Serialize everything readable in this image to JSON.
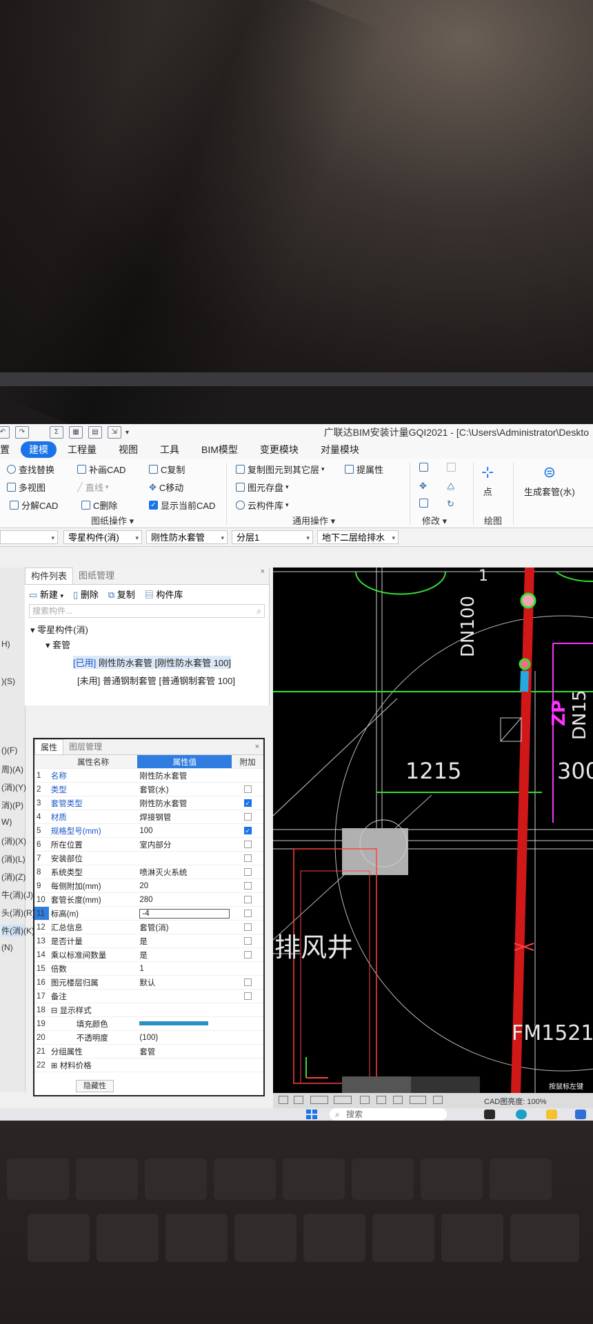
{
  "window": {
    "title": "广联达BIM安装计量GQI2021 - [C:\\Users\\Administrator\\Deskto"
  },
  "menu": [
    "置",
    "建模",
    "工程量",
    "视图",
    "工具",
    "BIM模型",
    "变更模块",
    "对量模块"
  ],
  "ribbon": {
    "find_replace": "查找替换",
    "fill_cad": "补画CAD",
    "c_copy": "C复制",
    "copy_to_floor": "复制图元到其它层",
    "extract_attr": "提属性",
    "multi_view": "多视图",
    "line": "直线",
    "c_move": "C移动",
    "element_save": "图元存盘",
    "split_cad": "分解CAD",
    "c_delete": "C删除",
    "show_current_cad": "显示当前CAD",
    "cloud_lib": "云构件库",
    "group_drawing_ops": "图纸操作",
    "group_common_ops": "通用操作",
    "group_modify": "修改",
    "group_draw": "绘图",
    "point": "点",
    "gen_sleeve": "生成套管(水)"
  },
  "filters": {
    "category": "零星构件(消)",
    "component": "刚性防水套管",
    "layer": "分层1",
    "drawing": "地下二层给排水"
  },
  "left_strip": [
    "H)",
    ")(S)",
    "()(F)",
    "周)(A)",
    "(消)(Y)",
    "消)(P)",
    "W)",
    "(消)(X)",
    "(消)(L)",
    "(消)(Z)",
    "牛(消)(J)",
    "头(消)(R)",
    "件(消)(K)",
    "(N)"
  ],
  "component_list": {
    "tab_list": "构件列表",
    "tab_drawing": "图纸管理",
    "btn_new": "新建",
    "btn_delete": "删除",
    "btn_copy": "复制",
    "btn_lib": "构件库",
    "search_placeholder": "搜索构件...",
    "tree_root": "零星构件(消)",
    "tree_group": "套管",
    "item1_tag": "[已用]",
    "item1_text": "刚性防水套管 [刚性防水套管 100]",
    "item2_tag": "[未用]",
    "item2_text": "普通钢制套管 [普通钢制套管 100]"
  },
  "properties": {
    "tab_attr": "属性",
    "tab_layer": "图层管理",
    "col_name": "属性名称",
    "col_value": "属性值",
    "col_extra": "附加",
    "rows": [
      {
        "n": "1",
        "name": "名称",
        "value": "刚性防水套管",
        "blue": true,
        "check": "none"
      },
      {
        "n": "2",
        "name": "类型",
        "value": "套管(水)",
        "blue": true,
        "check": "off"
      },
      {
        "n": "3",
        "name": "套管类型",
        "value": "刚性防水套管",
        "blue": true,
        "check": "on"
      },
      {
        "n": "4",
        "name": "材质",
        "value": "焊接钢管",
        "blue": true,
        "check": "off"
      },
      {
        "n": "5",
        "name": "规格型号(mm)",
        "value": "100",
        "blue": true,
        "check": "on"
      },
      {
        "n": "6",
        "name": "所在位置",
        "value": "室内部分",
        "blue": false,
        "check": "off"
      },
      {
        "n": "7",
        "name": "安装部位",
        "value": "",
        "blue": false,
        "check": "off"
      },
      {
        "n": "8",
        "name": "系统类型",
        "value": "喷淋灭火系统",
        "blue": false,
        "check": "off"
      },
      {
        "n": "9",
        "name": "每侧附加(mm)",
        "value": "20",
        "blue": false,
        "check": "off"
      },
      {
        "n": "10",
        "name": "套管长度(mm)",
        "value": "280",
        "blue": false,
        "check": "off"
      },
      {
        "n": "11",
        "name": "标高(m)",
        "value": "-4",
        "blue": false,
        "check": "off",
        "editing": true
      },
      {
        "n": "12",
        "name": "汇总信息",
        "value": "套管(消)",
        "blue": false,
        "check": "off"
      },
      {
        "n": "13",
        "name": "是否计量",
        "value": "是",
        "blue": false,
        "check": "off"
      },
      {
        "n": "14",
        "name": "乘以标准间数量",
        "value": "是",
        "blue": false,
        "check": "off"
      },
      {
        "n": "15",
        "name": "倍数",
        "value": "1",
        "blue": false,
        "check": "none"
      },
      {
        "n": "16",
        "name": "图元楼层归属",
        "value": "默认",
        "blue": false,
        "check": "off"
      },
      {
        "n": "17",
        "name": "备注",
        "value": "",
        "blue": false,
        "check": "off"
      },
      {
        "n": "18",
        "name": "⊟ 显示样式",
        "value": "",
        "blue": false,
        "check": "none"
      },
      {
        "n": "19",
        "name": "填充颜色",
        "value": "",
        "blue": false,
        "check": "none",
        "color": true,
        "indent": true
      },
      {
        "n": "20",
        "name": "不透明度",
        "value": "(100)",
        "blue": false,
        "check": "none",
        "indent": true
      },
      {
        "n": "21",
        "name": "分组属性",
        "value": "套管",
        "blue": false,
        "check": "none"
      },
      {
        "n": "22",
        "name": "⊞ 材料价格",
        "value": "",
        "blue": false,
        "check": "none"
      }
    ],
    "bottom_btn": "隐藏性",
    "fill_color": "#2c8fc3"
  },
  "cad": {
    "label_dn100": "DN100",
    "label_zp": "ZP",
    "label_dn150": "DN15",
    "label_1215": "1215",
    "label_300": "300",
    "label_shaft": "排风井",
    "label_fm": "FM1521",
    "label_one": "1",
    "hint": "按鼠标左键"
  },
  "status": {
    "cad_brightness": "CAD图亮度: 100%"
  },
  "taskbar": {
    "search": "搜索"
  },
  "colors": {
    "accent": "#1a73e8",
    "pipe_red": "#d01818",
    "cad_green": "#36e036",
    "cad_magenta": "#ff33ff"
  }
}
